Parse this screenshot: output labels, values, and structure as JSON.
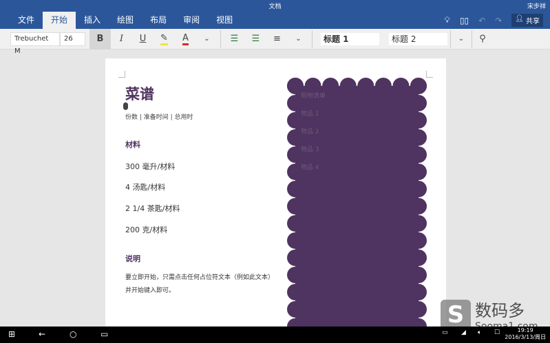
{
  "window": {
    "title": "文档",
    "user": "宋步祥",
    "share": "共享"
  },
  "tabs": [
    {
      "label": "文件"
    },
    {
      "label": "开始"
    },
    {
      "label": "插入"
    },
    {
      "label": "绘图"
    },
    {
      "label": "布局"
    },
    {
      "label": "审阅"
    },
    {
      "label": "视图"
    }
  ],
  "toolbar": {
    "font": "Trebuchet M",
    "size": "26",
    "bold": "B",
    "italic": "I",
    "underline": "U",
    "font_color": "A",
    "style1": "标题 1",
    "style2": "标题 2",
    "highlight_color": "#f4e33a",
    "text_color": "#d32a2a"
  },
  "document": {
    "title": "菜谱",
    "meta": "份数 | 准备时间 | 总用时",
    "ingredients_heading": "材料",
    "ingredients": [
      "300 毫升/材料",
      "4 汤匙/材料",
      "2 1/4 茶匙/材料",
      "200 克/材料"
    ],
    "instructions_heading": "说明",
    "instructions": "要立即开始，只需点击任何占位符文本（例如此文本）并开始键入即可。",
    "accent": "#4f3360"
  },
  "shopping": {
    "title": "购物清单",
    "items": [
      "物品 1",
      "物品 2",
      "物品 3",
      "物品 4"
    ]
  },
  "taskbar": {
    "time": "19:19",
    "date": "2016/3/13/周日"
  },
  "watermark": {
    "name": "数码多",
    "site": "Sooma1.com"
  }
}
